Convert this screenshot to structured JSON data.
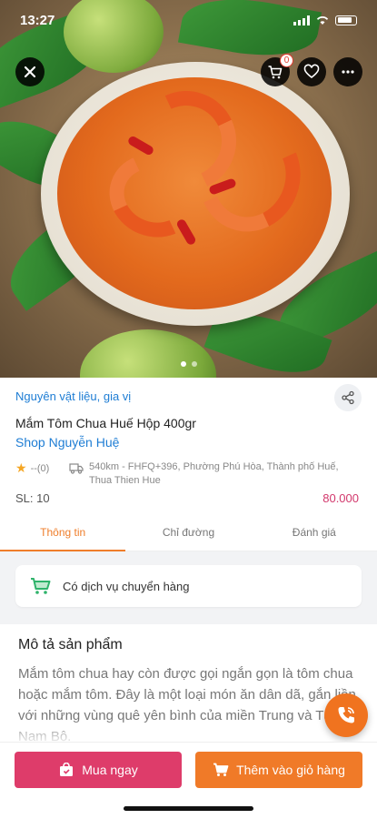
{
  "status_bar": {
    "time": "13:27"
  },
  "header": {
    "cart_count": "0"
  },
  "product": {
    "category": "Nguyên vật liệu, gia vị",
    "name": "Mắm Tôm Chua Huế Hộp 400gr",
    "shop": "Shop Nguyễn Huệ",
    "rating": "--(0)",
    "location": "540km - FHFQ+396, Phường Phú Hòa, Thành phố Huế, Thua Thien Hue",
    "stock": "SL: 10",
    "price": "80.000"
  },
  "tabs": [
    {
      "label": "Thông tin",
      "active": true
    },
    {
      "label": "Chỉ đường",
      "active": false
    },
    {
      "label": "Đánh giá",
      "active": false
    }
  ],
  "shipping": {
    "label": "Có dịch vụ chuyển hàng"
  },
  "description": {
    "title": "Mô tả sản phẩm",
    "body": "Mắm tôm chua hay còn được gọi ngắn gọn là tôm chua hoặc mắm tôm. Đây là một loại món ăn dân dã, gắn liền với những vùng quê yên bình của miền Trung và Tây Nam Bộ."
  },
  "actions": {
    "buy_now": "Mua ngay",
    "add_to_cart": "Thêm vào giỏ hàng"
  },
  "colors": {
    "accent_orange": "#ef7d2a",
    "buy_pink": "#de3c6a",
    "link_blue": "#1e7dd4",
    "price_pink": "#d2386c"
  },
  "icons": [
    "close-icon",
    "cart-icon",
    "heart-icon",
    "more-icon",
    "share-icon",
    "star-icon",
    "truck-icon",
    "cart-delivery-icon",
    "phone-icon",
    "buy-bag-icon"
  ]
}
